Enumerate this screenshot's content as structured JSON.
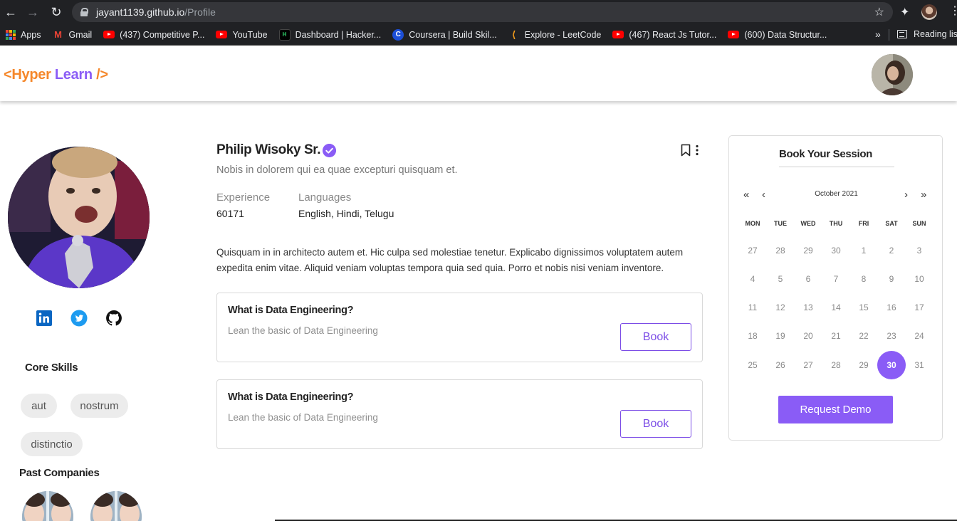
{
  "browser": {
    "url_host": "jayant1139.github.io",
    "url_path": "/Profile",
    "bookmarks": [
      {
        "label": "Apps",
        "icon": "apps-grid-icon"
      },
      {
        "label": "Gmail",
        "icon": "gmail-icon"
      },
      {
        "label": "(437) Competitive P...",
        "icon": "youtube-icon"
      },
      {
        "label": "YouTube",
        "icon": "youtube-icon"
      },
      {
        "label": "Dashboard | Hacker...",
        "icon": "hackerrank-icon"
      },
      {
        "label": "Coursera | Build Skil...",
        "icon": "coursera-icon"
      },
      {
        "label": "Explore - LeetCode",
        "icon": "leetcode-icon"
      },
      {
        "label": "(467) React Js Tutor...",
        "icon": "youtube-icon"
      },
      {
        "label": "(600) Data Structur...",
        "icon": "youtube-icon"
      }
    ],
    "more_label": "»",
    "reading_list": "Reading list"
  },
  "header": {
    "logo": {
      "part1": "<Hyper",
      "part2": "Learn",
      "part3": "/>"
    }
  },
  "profile": {
    "name": "Philip Wisoky Sr.",
    "tagline": "Nobis in dolorem qui ea quae excepturi quisquam et.",
    "experience_label": "Experience",
    "experience_value": "60171",
    "languages_label": "Languages",
    "languages_value": "English, Hindi, Telugu",
    "bio": "Quisquam in in architecto autem et. Hic culpa sed molestiae tenetur. Explicabo dignissimos voluptatem autem expedita enim vitae. Aliquid veniam voluptas tempora quia sed quia. Porro et nobis nisi veniam inventore.",
    "core_skills_title": "Core Skills",
    "skills": [
      "aut",
      "nostrum",
      "distinctio"
    ],
    "past_companies_title": "Past Companies"
  },
  "courses": [
    {
      "title": "What is Data Engineering?",
      "subtitle": "Lean the basic of Data Engineering",
      "button": "Book"
    },
    {
      "title": "What is Data Engineering?",
      "subtitle": "Lean the basic of Data Engineering",
      "button": "Book"
    }
  ],
  "calendar": {
    "title": "Book Your Session",
    "month": "October 2021",
    "nav": {
      "prev_year": "«",
      "prev_month": "‹",
      "next_month": "›",
      "next_year": "»"
    },
    "weekdays": [
      "MON",
      "TUE",
      "WED",
      "THU",
      "FRI",
      "SAT",
      "SUN"
    ],
    "weeks": [
      [
        "27",
        "28",
        "29",
        "30",
        "1",
        "2",
        "3"
      ],
      [
        "4",
        "5",
        "6",
        "7",
        "8",
        "9",
        "10"
      ],
      [
        "11",
        "12",
        "13",
        "14",
        "15",
        "16",
        "17"
      ],
      [
        "18",
        "19",
        "20",
        "21",
        "22",
        "23",
        "24"
      ],
      [
        "25",
        "26",
        "27",
        "28",
        "29",
        "30",
        "31"
      ]
    ],
    "selected_day": "30",
    "request_button": "Request Demo"
  },
  "colors": {
    "accent": "#8a5cf6",
    "logo_orange": "#f5872a",
    "linkedin": "#0a66c2",
    "twitter": "#1d9bf0"
  }
}
